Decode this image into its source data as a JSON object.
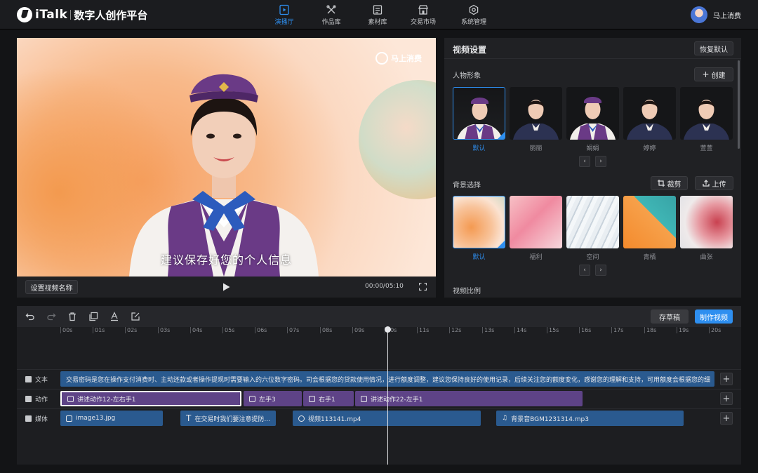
{
  "header": {
    "logo_text": "iTalk",
    "logo_sub": "数字人创作平台",
    "nav": [
      {
        "label": "演播厅",
        "icon": "studio-icon",
        "active": true
      },
      {
        "label": "作品库",
        "icon": "works-icon",
        "active": false
      },
      {
        "label": "素材库",
        "icon": "materials-icon",
        "active": false
      },
      {
        "label": "交易市场",
        "icon": "market-icon",
        "active": false
      },
      {
        "label": "系统管理",
        "icon": "settings-icon",
        "active": false
      }
    ],
    "user_name": "马上消费"
  },
  "preview": {
    "brand": "马上消费",
    "subtitle": "建议保存好您的个人信息",
    "set_name_button": "设置视频名称",
    "time": "00:00/05:10"
  },
  "settings": {
    "title": "视频设置",
    "reset_button": "恢复默认",
    "avatar_section": "人物形象",
    "create_button": "创建",
    "avatars": [
      "默认",
      "丽丽",
      "娟娟",
      "婷婷",
      "萱萱"
    ],
    "background_section": "背景选择",
    "crop_button": "裁剪",
    "upload_button": "上传",
    "backgrounds": [
      "默认",
      "福利",
      "空间",
      "青橘",
      "曲张"
    ],
    "ratio_section": "视频比例"
  },
  "timeline": {
    "save_draft": "存草稿",
    "make_video": "制作视频",
    "ruler": [
      "00s",
      "01s",
      "02s",
      "03s",
      "04s",
      "05s",
      "06s",
      "07s",
      "08s",
      "09s",
      "10s",
      "11s",
      "12s",
      "13s",
      "14s",
      "15s",
      "16s",
      "17s",
      "18s",
      "19s",
      "20s"
    ],
    "tracks": {
      "text": {
        "label": "文本",
        "clips": [
          "交易密码是您在操作支付消费时、主动还款或者操作提现时需要输入的六位数字密码。司会根据您的贷款使用情况，进行额度调整，建议您保持良好的使用记录，后续关注您的额度变化，感谢您的理解和支持，可用额度会根据您的细"
        ]
      },
      "action": {
        "label": "动作",
        "clips": [
          "讲述动作12-左右手1",
          "左手3",
          "右手1",
          "讲述动作22-左手1"
        ]
      },
      "media": {
        "label": "媒体",
        "clips": [
          "image13.jpg",
          "在交易时我们要注意提防...",
          "视频113141.mp4",
          "背景音BGM1231314.mp3"
        ]
      }
    }
  },
  "colors": {
    "accent": "#2e8ff0",
    "action_clip": "#5e4387",
    "media_clip": "#2a5a8f"
  }
}
